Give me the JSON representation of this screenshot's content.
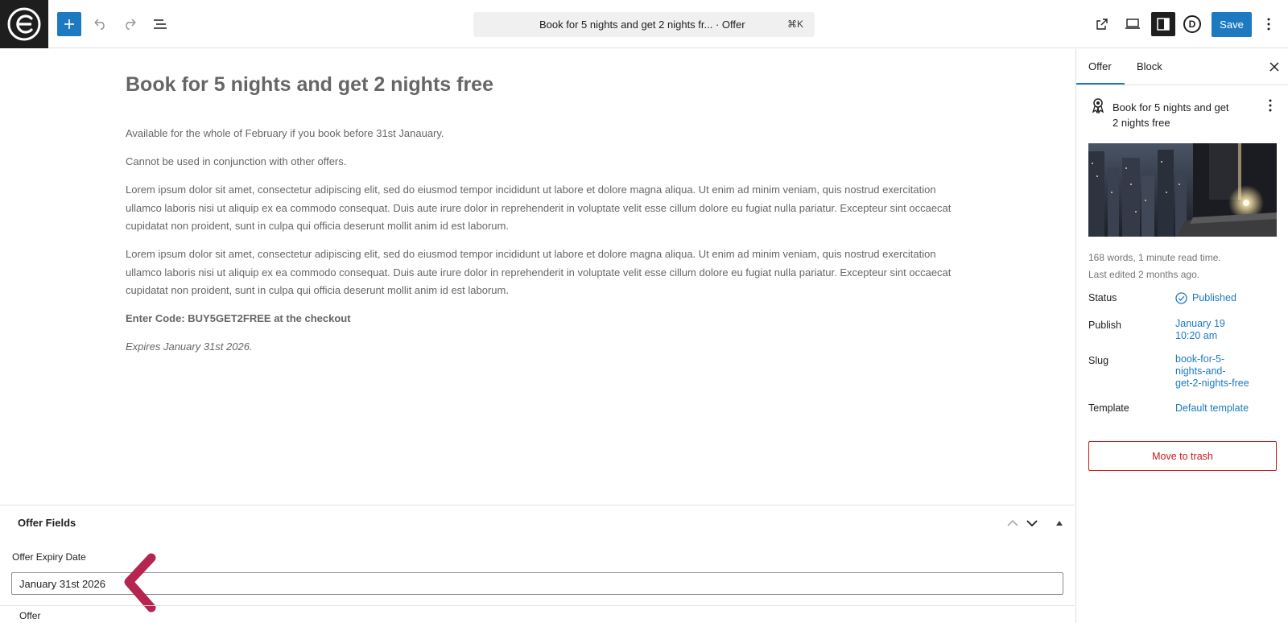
{
  "topbar": {
    "logo_icon": "editor-logo-icon",
    "add_icon": "plus-icon",
    "undo_icon": "undo-icon",
    "redo_icon": "redo-icon",
    "list_view_icon": "list-view-icon",
    "command_title": "Book for 5 nights and get 2 nights fr...  · Offer",
    "command_shortcut": "⌘K",
    "view_icon": "external-link-icon",
    "preview_icon": "desktop-preview-icon",
    "settings_icon": "sidebar-toggle-icon",
    "d_label": "D",
    "save_label": "Save",
    "more_icon": "more-vertical-icon",
    "accent_color": "#1d7ac0"
  },
  "editor": {
    "title": "Book for 5 nights and get 2 nights free",
    "paragraphs": [
      "Available for the whole of February if you book before 31st Janauary.",
      "Cannot be used in conjunction with other offers.",
      "Lorem ipsum dolor sit amet, consectetur adipiscing elit, sed do eiusmod tempor incididunt ut labore et dolore magna aliqua. Ut enim ad minim veniam, quis nostrud exercitation ullamco laboris nisi ut aliquip ex ea commodo consequat. Duis aute irure dolor in reprehenderit in voluptate velit esse cillum dolore eu fugiat nulla pariatur. Excepteur sint occaecat cupidatat non proident, sunt in culpa qui officia deserunt mollit anim id est laborum.",
      "Lorem ipsum dolor sit amet, consectetur adipiscing elit, sed do eiusmod tempor incididunt ut labore et dolore magna aliqua. Ut enim ad minim veniam, quis nostrud exercitation ullamco laboris nisi ut aliquip ex ea commodo consequat. Duis aute irure dolor in reprehenderit in voluptate velit esse cillum dolore eu fugiat nulla pariatur. Excepteur sint occaecat cupidatat non proident, sunt in culpa qui officia deserunt mollit anim id est laborum."
    ],
    "code_line": "Enter Code: BUY5GET2FREE at the checkout",
    "expires_line": "Expires January 31st 2026."
  },
  "meta_box": {
    "title": "Offer Fields",
    "field_label": "Offer Expiry Date",
    "field_value": "January 31st 2026",
    "annotation_color": "#b5254f"
  },
  "footer": {
    "breadcrumb": "Offer"
  },
  "sidebar": {
    "tabs": [
      "Offer",
      "Block"
    ],
    "active_tab": "Offer",
    "doc_title": "Book for 5 nights and get 2 nights free",
    "doc_icon": "award-icon",
    "meta_line1": "168 words, 1 minute read time.",
    "meta_line2": "Last edited 2 months ago.",
    "rows": {
      "status_label": "Status",
      "status_value": "Published",
      "publish_label": "Publish",
      "publish_date": "January 19",
      "publish_time": "10:20 am",
      "slug_label": "Slug",
      "slug_line1": "book-for-5-",
      "slug_line2": "nights-and-",
      "slug_line3": "get-2-nights-free",
      "template_label": "Template",
      "template_value": "Default template"
    },
    "trash_label": "Move to trash",
    "trash_color": "#cc1818"
  }
}
